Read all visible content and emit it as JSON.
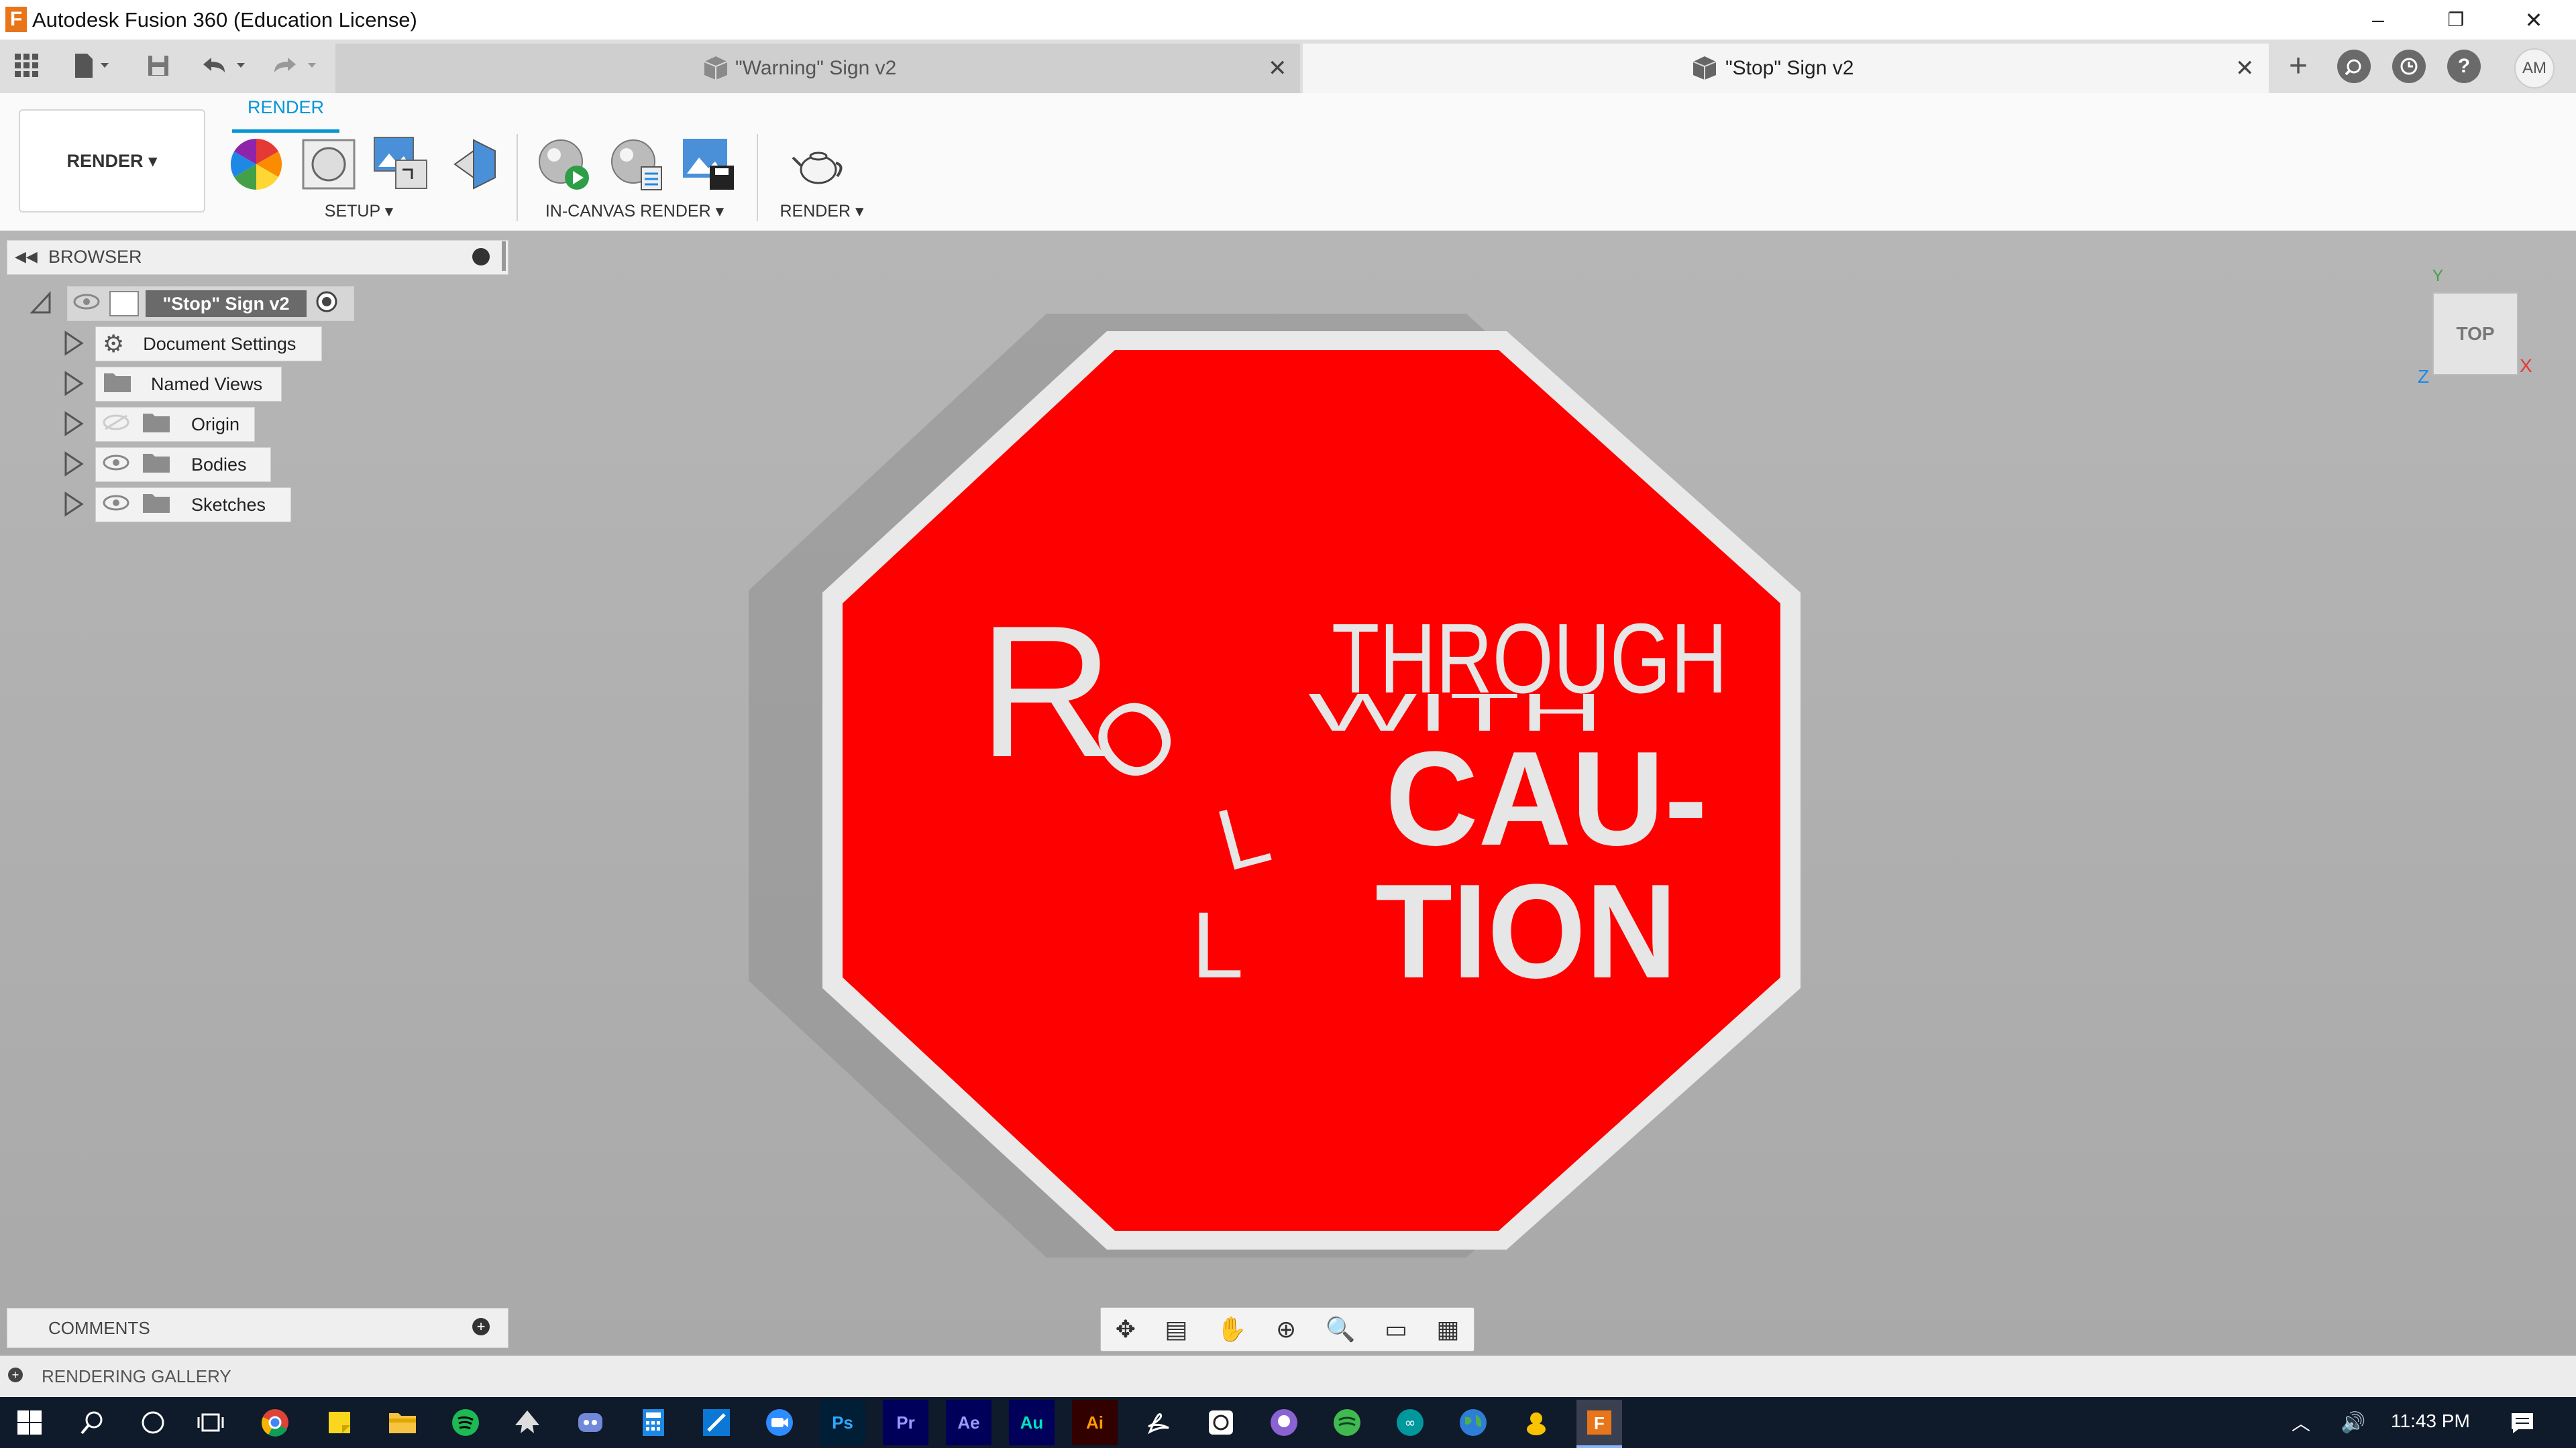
{
  "window": {
    "title": "Autodesk Fusion 360 (Education License)",
    "logo": "F",
    "min": "–",
    "restore": "❐",
    "close": "✕"
  },
  "tabs": [
    {
      "label": "\"Warning\" Sign v2",
      "close": "✕"
    },
    {
      "label": "\"Stop\" Sign v2",
      "close": "✕"
    }
  ],
  "quick_access": {
    "new_tab": "+",
    "avatar": "AM"
  },
  "ribbon": {
    "workspace": "RENDER ▾",
    "active_tab": "RENDER",
    "groups": [
      "SETUP ▾",
      "IN-CANVAS RENDER ▾",
      "RENDER ▾"
    ]
  },
  "browser": {
    "title": "BROWSER",
    "root": "\"Stop\" Sign v2",
    "items": [
      "Document Settings",
      "Named Views",
      "Origin",
      "Bodies",
      "Sketches"
    ]
  },
  "viewcube": {
    "face": "TOP",
    "axis_y": "Y",
    "axis_x": "X",
    "axis_z": "Z"
  },
  "model": {
    "letter_r": "R",
    "line1": "THROUGH",
    "line2": "WITH",
    "line3": "CAU-",
    "line4": "TION",
    "oll": [
      "O",
      "L",
      "L"
    ]
  },
  "comments": {
    "title": "COMMENTS"
  },
  "gallery": {
    "title": "RENDERING GALLERY"
  },
  "taskbar": {
    "time": "11:43 PM"
  },
  "colors": {
    "accent": "#0696d7",
    "sign_red": "#ff0000",
    "sign_border": "#e8e8e8"
  }
}
